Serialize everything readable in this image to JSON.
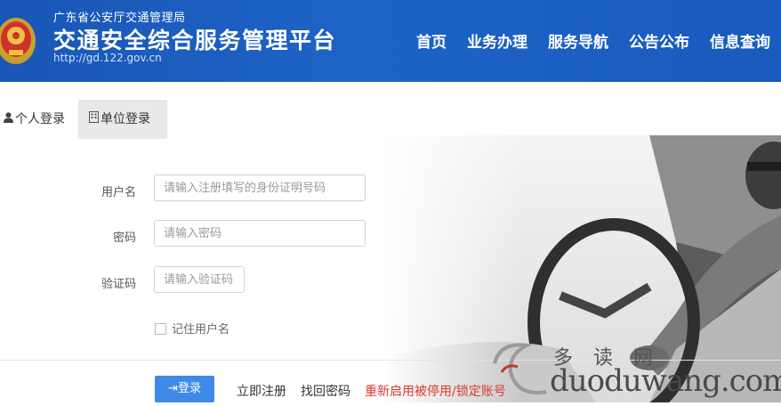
{
  "header": {
    "department": "广东省公安厅交通管理局",
    "title": "交通安全综合服务管理平台",
    "url": "http://gd.122.gov.cn",
    "nav": [
      "首页",
      "业务办理",
      "服务导航",
      "公告公布",
      "信息查询"
    ]
  },
  "tabs": {
    "personal": "个人登录",
    "organization": "单位登录"
  },
  "form": {
    "username_label": "用户名",
    "username_placeholder": "请输入注册填写的身份证明号码",
    "password_label": "密码",
    "password_placeholder": "请输入密码",
    "captcha_label": "验证码",
    "captcha_placeholder": "请输入验证码",
    "remember_label": "记住用户名"
  },
  "actions": {
    "login": "登录",
    "register": "立即注册",
    "forgot": "找回密码",
    "reenable": "重新启用被停用/锁定账号"
  },
  "watermark": {
    "cn": "多 读 网",
    "domain": "duoduwang.com"
  },
  "colors": {
    "header_blue": "#1d63c6",
    "button_blue": "#3f8ae8",
    "warning_red": "#d93a2f"
  }
}
